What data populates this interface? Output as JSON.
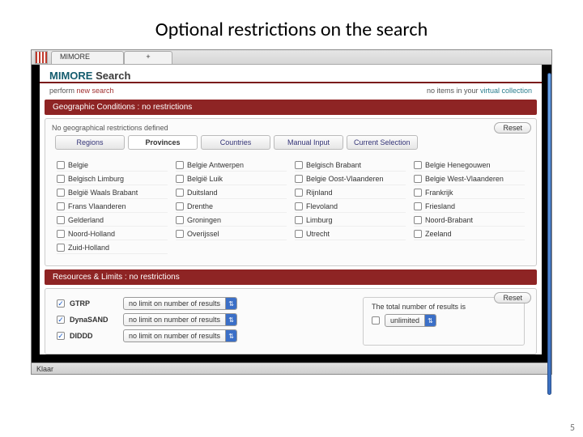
{
  "slide": {
    "title": "Optional restrictions on the search",
    "number": "5"
  },
  "browser": {
    "tab": "MIMORE",
    "plus": "+",
    "status": "Klaar"
  },
  "header": {
    "brand_a": "MIMORE",
    "brand_b": " Search"
  },
  "subbar": {
    "perform": "perform ",
    "newsearch": "new search",
    "noitems": "no items in your ",
    "vc": "virtual collection"
  },
  "geo": {
    "header": "Geographic Conditions : no restrictions",
    "note": "No geographical restrictions defined",
    "reset": "Reset",
    "tabs": [
      "Regions",
      "Provinces",
      "Countries",
      "Manual Input",
      "Current Selection"
    ],
    "active_tab": 1,
    "provinces": [
      "Belgie",
      "Belgie Antwerpen",
      "Belgisch Brabant",
      "Belgie Henegouwen",
      "Belgisch Limburg",
      "België Luik",
      "Belgie Oost-Vlaanderen",
      "Belgie West-Vlaanderen",
      "België Waals Brabant",
      "Duitsland",
      "Rijnland",
      "Frankrijk",
      "Frans Vlaanderen",
      "Drenthe",
      "Flevoland",
      "Friesland",
      "Gelderland",
      "Groningen",
      "Limburg",
      "Noord-Brabant",
      "Noord-Holland",
      "Overijssel",
      "Utrecht",
      "Zeeland",
      "Zuid-Holland"
    ]
  },
  "res": {
    "header": "Resources & Limits : no restrictions",
    "reset": "Reset",
    "items": [
      {
        "name": "GTRP",
        "checked": true,
        "limit": "no limit on number of results"
      },
      {
        "name": "DynaSAND",
        "checked": true,
        "limit": "no limit on number of results"
      },
      {
        "name": "DIDDD",
        "checked": true,
        "limit": "no limit on number of results"
      }
    ],
    "total_label": "The total number of results is",
    "total_value": "unlimited"
  }
}
